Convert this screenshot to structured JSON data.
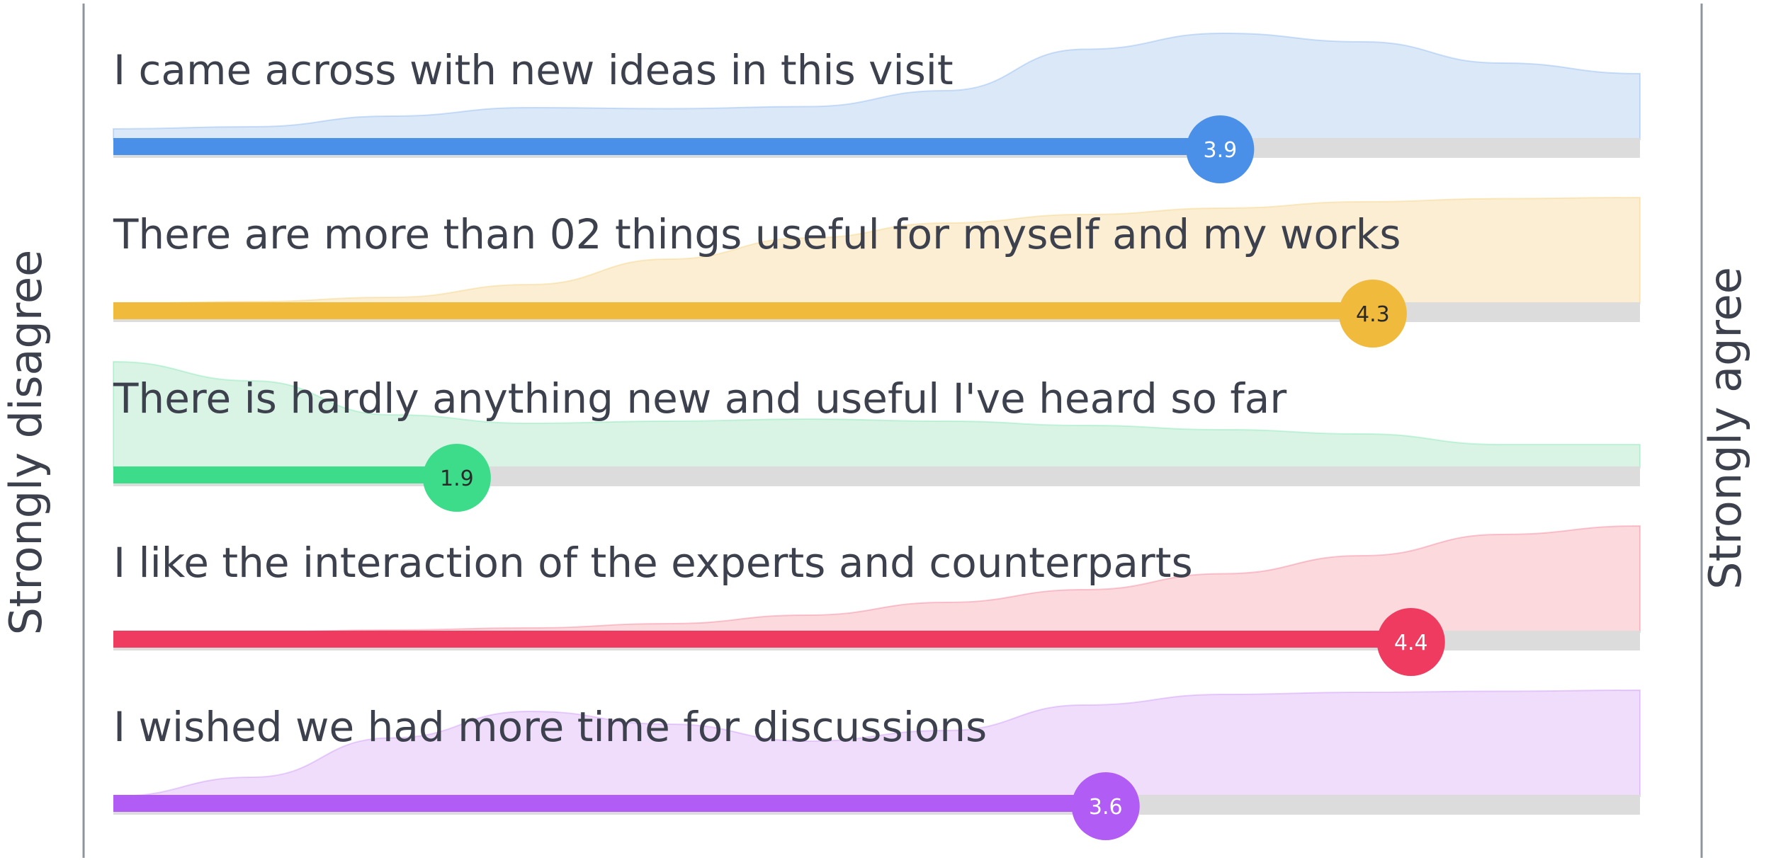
{
  "chart_data": {
    "type": "bar",
    "orientation": "horizontal",
    "scale_left_label": "Strongly disagree",
    "scale_right_label": "Strongly agree",
    "xlim": [
      1,
      5
    ],
    "grid": false,
    "items": [
      {
        "statement": "I came across with new ideas in this visit",
        "value": 3.9,
        "value_label": "3.9",
        "color": "#4a90e8",
        "fill": "#dbe8f8",
        "label_color": "#ffffff",
        "distribution": [
          0.1,
          0.12,
          0.22,
          0.3,
          0.29,
          0.31,
          0.46,
          0.85,
          1.0,
          0.92,
          0.72,
          0.62
        ]
      },
      {
        "statement": "There are more than 02 things useful for myself and my works",
        "value": 4.3,
        "value_label": "4.3",
        "color": "#f0ba3c",
        "fill": "#fbeed2",
        "label_color": "#2a2a2a",
        "distribution": [
          0.0,
          0.02,
          0.06,
          0.18,
          0.42,
          0.62,
          0.76,
          0.84,
          0.9,
          0.96,
          0.99,
          1.0
        ]
      },
      {
        "statement": "There is hardly anything new and useful I've heard so far",
        "value": 1.9,
        "value_label": "1.9",
        "color": "#3ddc8a",
        "fill": "#d9f4e4",
        "label_color": "#2a2a2a",
        "distribution": [
          1.0,
          0.82,
          0.5,
          0.42,
          0.44,
          0.46,
          0.44,
          0.4,
          0.36,
          0.32,
          0.22,
          0.22
        ]
      },
      {
        "statement": "I like the interaction of the experts and counterparts",
        "value": 4.4,
        "value_label": "4.4",
        "color": "#ef3b5f",
        "fill": "#fbd9dd",
        "label_color": "#ffffff",
        "distribution": [
          0.0,
          0.0,
          0.02,
          0.04,
          0.08,
          0.16,
          0.28,
          0.4,
          0.55,
          0.72,
          0.92,
          1.0
        ]
      },
      {
        "statement": "I wished we had more time for discussions",
        "value": 3.6,
        "value_label": "3.6",
        "color": "#b15cf5",
        "fill": "#efddfb",
        "label_color": "#ffffff",
        "distribution": [
          0.0,
          0.18,
          0.55,
          0.8,
          0.68,
          0.52,
          0.62,
          0.86,
          0.96,
          0.98,
          0.99,
          1.0
        ]
      }
    ]
  }
}
